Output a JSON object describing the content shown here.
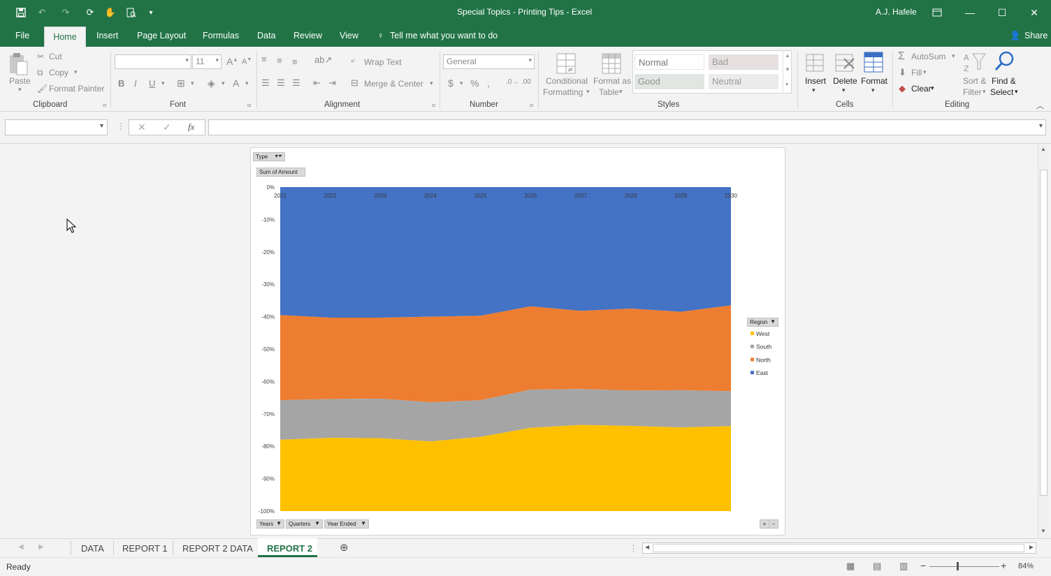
{
  "window": {
    "title": "Special Topics - Printing Tips  -  Excel",
    "user": "A.J. Hafele",
    "share": "Share"
  },
  "tabs": [
    "File",
    "Home",
    "Insert",
    "Page Layout",
    "Formulas",
    "Data",
    "Review",
    "View"
  ],
  "tell_me": "Tell me what you want to do",
  "ribbon": {
    "clipboard": {
      "label": "Clipboard",
      "paste": "Paste",
      "cut": "Cut",
      "copy": "Copy",
      "format_painter": "Format Painter"
    },
    "font": {
      "label": "Font",
      "size": "11",
      "bold": "B",
      "italic": "I",
      "underline": "U"
    },
    "alignment": {
      "label": "Alignment",
      "wrap": "Wrap Text",
      "merge": "Merge & Center"
    },
    "number": {
      "label": "Number",
      "format": "General"
    },
    "styles": {
      "label": "Styles",
      "conditional": "Conditional",
      "conditional2": "Formatting",
      "format_as": "Format as",
      "format_as2": "Table",
      "normal": "Normal",
      "bad": "Bad",
      "good": "Good",
      "neutral": "Neutral"
    },
    "cells": {
      "label": "Cells",
      "insert": "Insert",
      "delete": "Delete",
      "format": "Format"
    },
    "editing": {
      "label": "Editing",
      "autosum": "AutoSum",
      "fill": "Fill",
      "clear": "Clear",
      "sort": "Sort &",
      "sort2": "Filter",
      "find": "Find &",
      "find2": "Select"
    }
  },
  "formula_bar": {
    "name_box": "",
    "formula": "",
    "fx": "fx"
  },
  "pivot_buttons": {
    "type": "Type",
    "sum": "Sum of Amount",
    "years": "Years",
    "quarters": "Quarters",
    "year_ended": "Year Ended",
    "region": "Region"
  },
  "chart_data": {
    "type": "area",
    "stacked": "100%",
    "x": [
      "2021",
      "2022",
      "2023",
      "2024",
      "2025",
      "2026",
      "2027",
      "2028",
      "2029",
      "2030"
    ],
    "ylim": [
      -100,
      0
    ],
    "yticks": [
      "0%",
      "-10%",
      "-20%",
      "-30%",
      "-40%",
      "-50%",
      "-60%",
      "-70%",
      "-80%",
      "-90%",
      "-100%"
    ],
    "legend_title": "Region",
    "legend_position": "right",
    "series": [
      {
        "name": "East",
        "color": "#4472c4",
        "values": [
          39.5,
          40.3,
          40.3,
          40.0,
          39.7,
          36.8,
          38.2,
          37.5,
          38.5,
          36.5
        ]
      },
      {
        "name": "North",
        "color": "#ed7d31",
        "values": [
          26.3,
          25.1,
          25.0,
          26.4,
          26.1,
          25.7,
          24.1,
          25.3,
          24.2,
          26.5
        ]
      },
      {
        "name": "South",
        "color": "#a5a5a5",
        "values": [
          12.2,
          12.0,
          12.2,
          12.1,
          11.3,
          11.8,
          11.1,
          10.9,
          11.5,
          10.8
        ]
      },
      {
        "name": "West",
        "color": "#ffc000",
        "values": [
          22.0,
          22.6,
          22.5,
          21.5,
          22.9,
          25.7,
          26.6,
          26.3,
          25.8,
          26.2
        ]
      }
    ],
    "legend_order": [
      "West",
      "South",
      "North",
      "East"
    ]
  },
  "sheet_tabs": [
    "DATA",
    "REPORT 1",
    "REPORT 2 DATA",
    "REPORT 2"
  ],
  "active_sheet": "REPORT 2",
  "status": {
    "ready": "Ready",
    "zoom": "84%"
  }
}
